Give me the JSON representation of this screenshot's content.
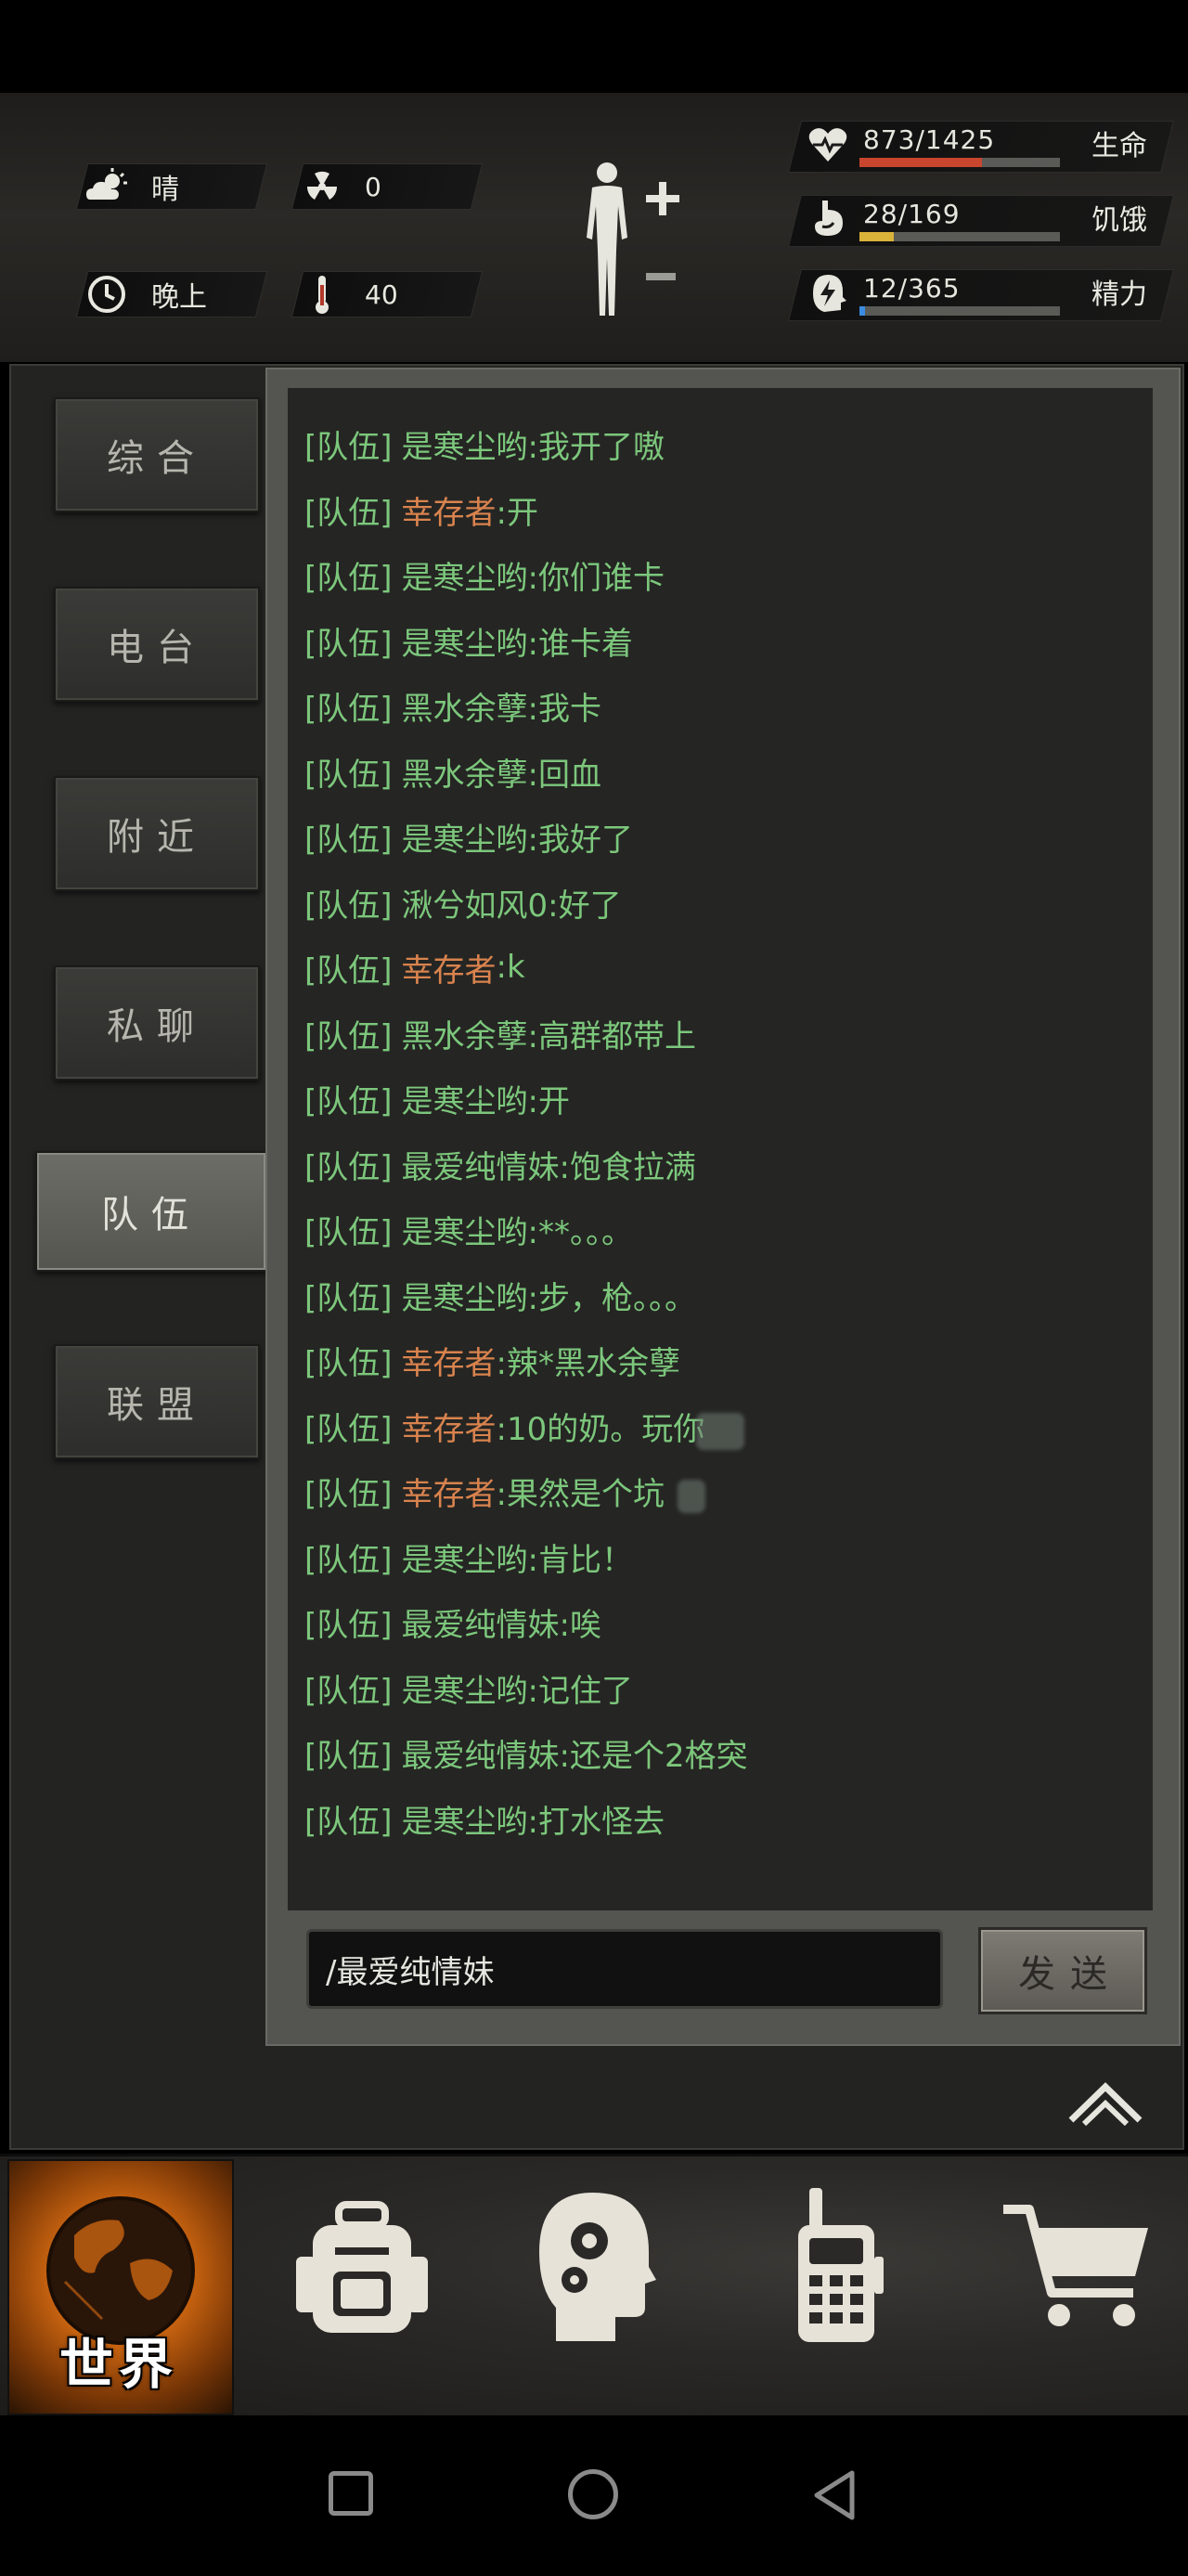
{
  "hud": {
    "weather": {
      "icon": "cloud-sun-icon",
      "label": "晴"
    },
    "radiation": {
      "icon": "radiation-icon",
      "value": "0"
    },
    "time_of_day": {
      "icon": "clock-icon",
      "label": "晚上"
    },
    "temperature": {
      "icon": "thermometer-icon",
      "value": "40"
    },
    "body_status": {
      "icon": "human-body-icon",
      "plus": "+",
      "minus": "−"
    },
    "stats": [
      {
        "key": "health",
        "icon": "heart-icon",
        "value": "873/1425",
        "label": "生命",
        "fraction": 0.61,
        "color": "#c8452e"
      },
      {
        "key": "hunger",
        "icon": "stomach-icon",
        "value": "28/169",
        "label": "饥饿",
        "fraction": 0.17,
        "color": "#d9b23a"
      },
      {
        "key": "energy",
        "icon": "lightning-head-icon",
        "value": "12/365",
        "label": "精力",
        "fraction": 0.03,
        "color": "#3b8be0"
      }
    ]
  },
  "sidebar": {
    "tabs": [
      {
        "label": "综合",
        "active": false
      },
      {
        "label": "电台",
        "active": false
      },
      {
        "label": "附近",
        "active": false
      },
      {
        "label": "私聊",
        "active": false
      },
      {
        "label": "队伍",
        "active": true
      },
      {
        "label": "联盟",
        "active": false
      }
    ]
  },
  "chat": {
    "messages": [
      {
        "channel": "[队伍]",
        "sender": "是寒尘哟",
        "sender_color": "green",
        "text": ":我开了嗷"
      },
      {
        "channel": "[队伍]",
        "sender": "幸存者",
        "sender_color": "orange",
        "text": ":开"
      },
      {
        "channel": "[队伍]",
        "sender": "是寒尘哟",
        "sender_color": "green",
        "text": ":你们谁卡"
      },
      {
        "channel": "[队伍]",
        "sender": "是寒尘哟",
        "sender_color": "green",
        "text": ":谁卡着"
      },
      {
        "channel": "[队伍]",
        "sender": "黑水余孽",
        "sender_color": "green",
        "text": ":我卡"
      },
      {
        "channel": "[队伍]",
        "sender": "黑水余孽",
        "sender_color": "green",
        "text": ":回血"
      },
      {
        "channel": "[队伍]",
        "sender": "是寒尘哟",
        "sender_color": "green",
        "text": ":我好了"
      },
      {
        "channel": "[队伍]",
        "sender": "湫兮如风0",
        "sender_color": "green",
        "text": ":好了"
      },
      {
        "channel": "[队伍]",
        "sender": "幸存者",
        "sender_color": "orange",
        "text": ":k"
      },
      {
        "channel": "[队伍]",
        "sender": "黑水余孽",
        "sender_color": "green",
        "text": ":高群都带上"
      },
      {
        "channel": "[队伍]",
        "sender": "是寒尘哟",
        "sender_color": "green",
        "text": ":开"
      },
      {
        "channel": "[队伍]",
        "sender": "最爱纯情妹",
        "sender_color": "green",
        "text": ":饱食拉满"
      },
      {
        "channel": "[队伍]",
        "sender": "是寒尘哟",
        "sender_color": "green",
        "text": ":**。。。"
      },
      {
        "channel": "[队伍]",
        "sender": "是寒尘哟",
        "sender_color": "green",
        "text": ":步，枪。。。"
      },
      {
        "channel": "[队伍]",
        "sender": "幸存者",
        "sender_color": "orange",
        "text": ":辣*黑水余孽"
      },
      {
        "channel": "[队伍]",
        "sender": "幸存者",
        "sender_color": "orange",
        "text": ":10的奶。玩你"
      },
      {
        "channel": "[队伍]",
        "sender": "幸存者",
        "sender_color": "orange",
        "text": ":果然是个坑"
      },
      {
        "channel": "[队伍]",
        "sender": "是寒尘哟",
        "sender_color": "green",
        "text": ":肯比！"
      },
      {
        "channel": "[队伍]",
        "sender": "最爱纯情妹",
        "sender_color": "green",
        "text": ":唉"
      },
      {
        "channel": "[队伍]",
        "sender": "是寒尘哟",
        "sender_color": "green",
        "text": ":记住了"
      },
      {
        "channel": "[队伍]",
        "sender": "最爱纯情妹",
        "sender_color": "green",
        "text": ":还是个2格突"
      },
      {
        "channel": "[队伍]",
        "sender": "是寒尘哟",
        "sender_color": "green",
        "text": ":打水怪去"
      }
    ],
    "input_value": "/最爱纯情妹",
    "send_label": "发送",
    "collapse_icon": "double-chevron-up-icon"
  },
  "bottom_nav": {
    "items": [
      {
        "key": "world",
        "label": "世界",
        "icon": "globe-icon",
        "active": true
      },
      {
        "key": "backpack",
        "icon": "backpack-icon"
      },
      {
        "key": "skills",
        "icon": "head-gears-icon"
      },
      {
        "key": "radio",
        "icon": "walkie-talkie-icon"
      },
      {
        "key": "shop",
        "icon": "shopping-cart-icon"
      }
    ]
  },
  "system_nav": {
    "recents": "square-icon",
    "home": "circle-icon",
    "back": "triangle-back-icon"
  },
  "colors": {
    "channel_green": "#7cc77c",
    "sender_orange": "#d9834e",
    "world_orange": "#d46a12"
  }
}
